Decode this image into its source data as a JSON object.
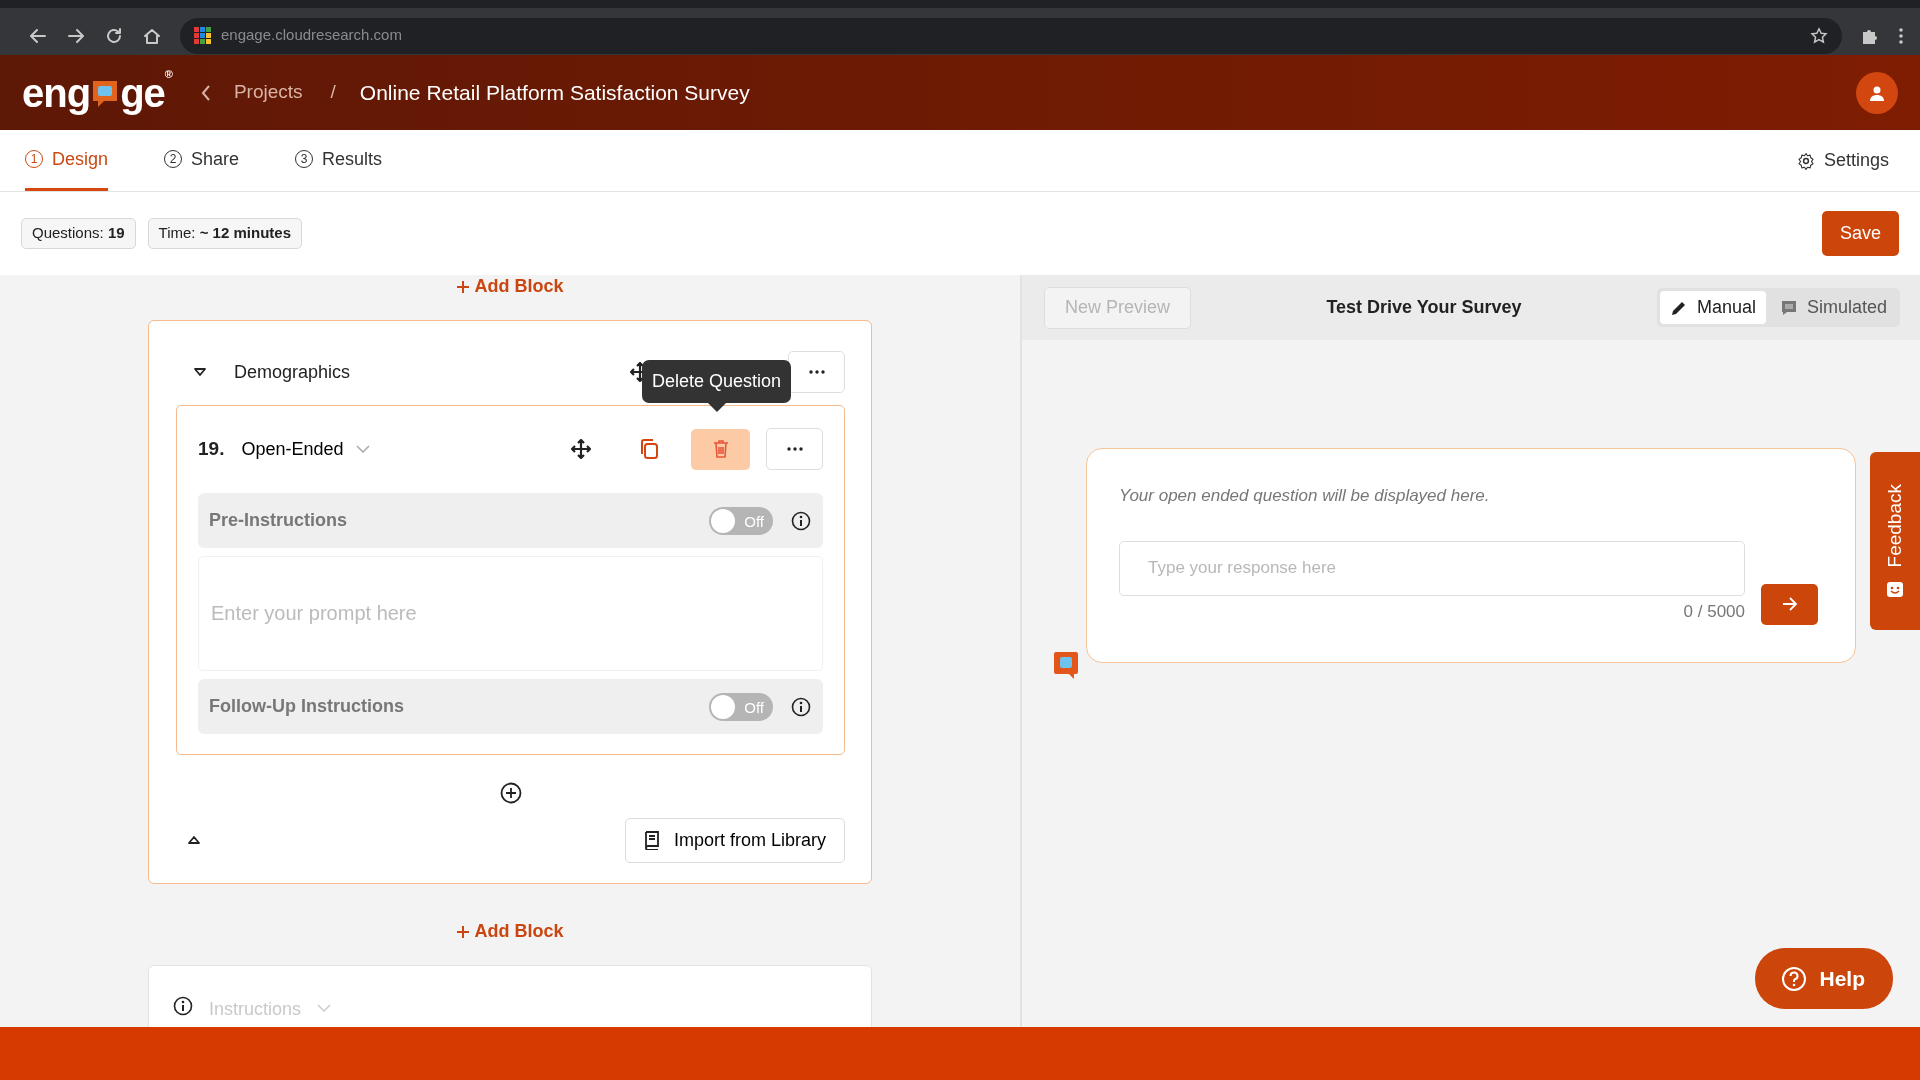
{
  "browser": {
    "url": "engage.cloudresearch.com"
  },
  "header": {
    "logo_start": "eng",
    "logo_end": "ge",
    "logo_mark": "®",
    "breadcrumb": "Projects",
    "separator": "/",
    "title": "Online Retail Platform Satisfaction Survey"
  },
  "tabs": [
    {
      "number": "1",
      "label": "Design",
      "selected": true
    },
    {
      "number": "2",
      "label": "Share",
      "selected": false
    },
    {
      "number": "3",
      "label": "Results",
      "selected": false
    }
  ],
  "settings": "Settings",
  "stats": [
    {
      "label": "Questions:",
      "value": "19"
    },
    {
      "label": "Time:",
      "value": "~ 12 minutes"
    }
  ],
  "save": "Save",
  "add_block_top": "Add Block",
  "block": {
    "name": "Demographics",
    "expanded": true,
    "tooltip": "Delete Question",
    "question": {
      "number": "19.",
      "type": "Open-Ended",
      "prompt_placeholder": "Enter your prompt here",
      "options": [
        {
          "label": "Pre-Instructions",
          "on": false,
          "state": "Off"
        },
        {
          "label": "Follow-Up Instructions",
          "on": false,
          "state": "Off"
        }
      ]
    },
    "import": "Import from Library"
  },
  "add_block_bottom": "Add Block",
  "next_block": {
    "name": "Instructions"
  },
  "preview": {
    "new_preview": "New Preview",
    "new_preview_disabled": true,
    "title": "Test Drive Your Survey",
    "modes": [
      {
        "kind": "manual",
        "label": "Manual",
        "selected": true
      },
      {
        "kind": "simulated",
        "label": "Simulated",
        "selected": false
      }
    ],
    "question": "Your open ended question will be displayed here.",
    "placeholder": "Type your response here",
    "counter": "0 / 5000"
  },
  "feedback": "Feedback",
  "help": "Help"
}
